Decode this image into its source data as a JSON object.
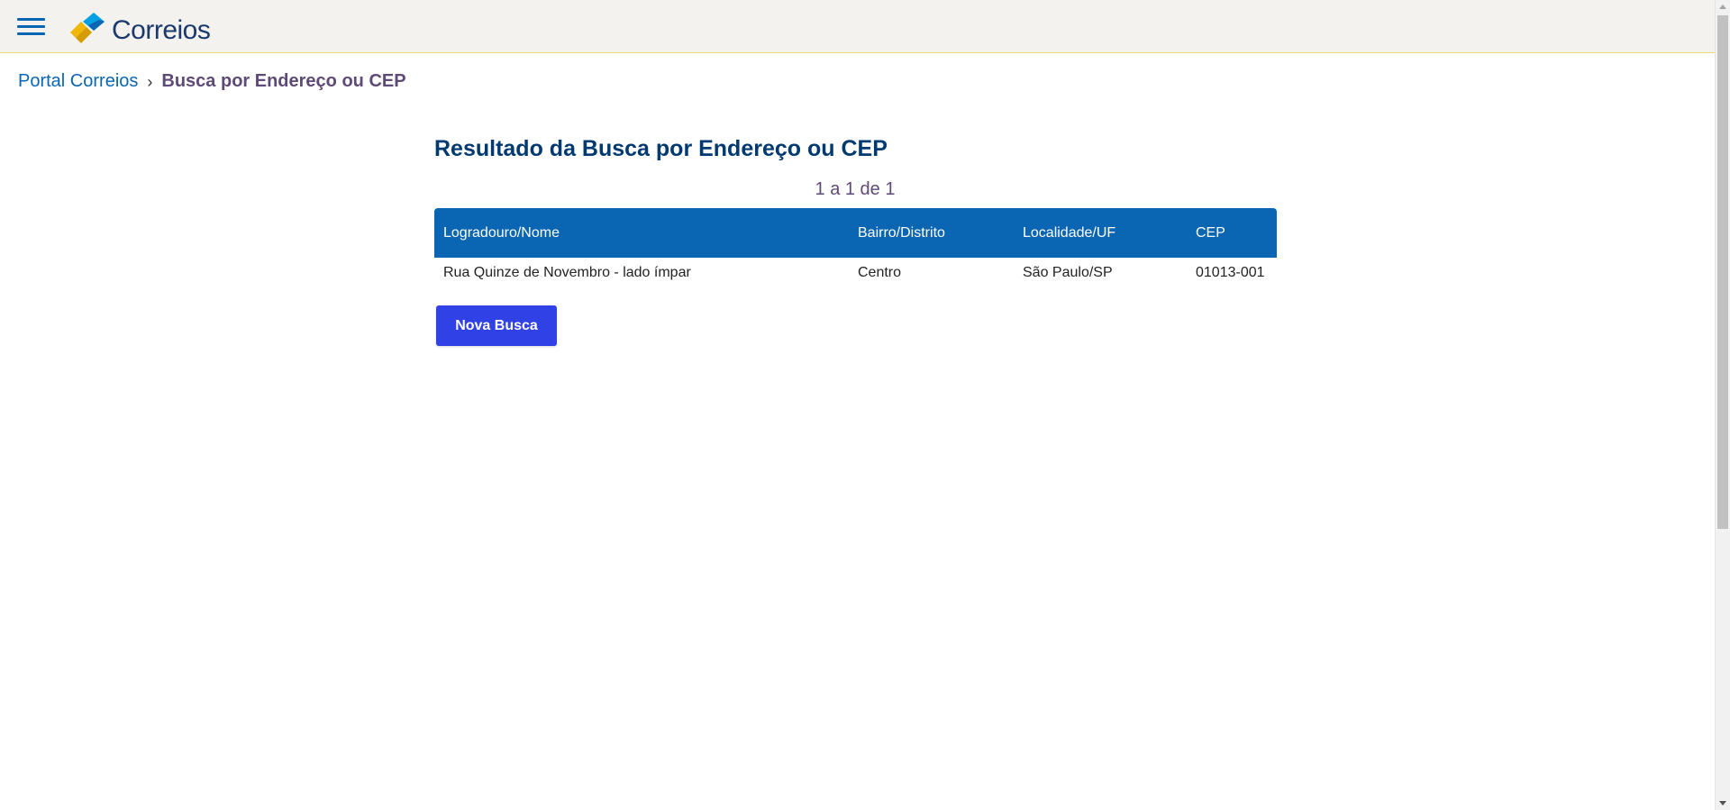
{
  "header": {
    "logo_text": "Correios",
    "colors": {
      "background": "#f3f2ef",
      "menu_icon": "#0a66b3",
      "logo_blue": "#1a3a6b",
      "logo_yellow": "#f2b705",
      "logo_light_blue": "#00a1e0"
    }
  },
  "breadcrumb": {
    "home_label": "Portal Correios",
    "separator": "›",
    "current_label": "Busca por Endereço ou CEP"
  },
  "main": {
    "title": "Resultado da Busca por Endereço ou CEP",
    "pagination": "1 a 1 de 1",
    "table": {
      "headers": [
        "Logradouro/Nome",
        "Bairro/Distrito",
        "Localidade/UF",
        "CEP"
      ],
      "rows": [
        [
          "Rua Quinze de Novembro - lado ímpar",
          "Centro",
          "São Paulo/SP",
          "01013-001"
        ]
      ]
    },
    "new_search_label": "Nova Busca"
  },
  "colors": {
    "table_header": "#0a66b3",
    "title": "#003a70",
    "button": "#3041e6"
  }
}
